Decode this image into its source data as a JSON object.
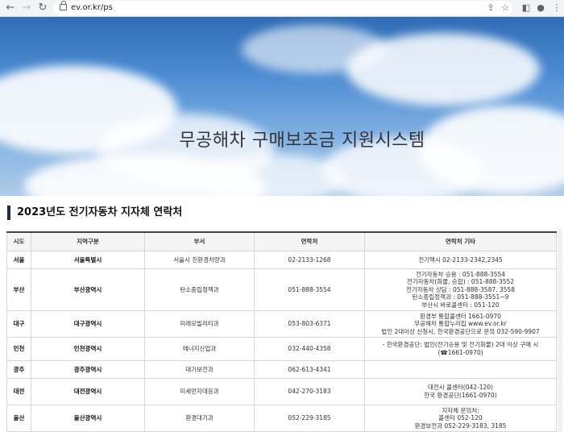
{
  "browser": {
    "url": "ev.or.kr/ps"
  },
  "hero": {
    "title": "무공해차 구매보조금 지원시스템"
  },
  "section": {
    "title": "2023년도 전기자동차 지자체 연락처"
  },
  "table": {
    "headers": [
      "시도",
      "지역구분",
      "부서",
      "연락처",
      "연락처 기타"
    ],
    "rows": [
      {
        "sido": "서울",
        "region": "서울특별시",
        "dept": "서울시 친환경차량과",
        "phone": "02-2133-1268",
        "etc": [
          "전기택시 02-2133-2342,2345"
        ]
      },
      {
        "sido": "부산",
        "region": "부산광역시",
        "dept": "탄소중립정책과",
        "phone": "051-888-3554",
        "etc": [
          "전기자동차 승용 : 051-888-3554",
          "전기자동차(화물, 승합) : 051-888-3552",
          "전기자동차 상담 : 051-888-3587, 3558",
          "탄소중립정책과 : 051-888-3551~9",
          "부산시 바로콜센터 : 051-120"
        ]
      },
      {
        "sido": "대구",
        "region": "대구광역시",
        "dept": "미래모빌리티과",
        "phone": "053-803-6371",
        "etc": [
          "환경부 통합콜센터 1661-0970",
          "무공해차 통합누리집 www.ev.or.kr",
          "법인 2대이상 신청시, 한국환경공단으로 문의 032-590-9907"
        ]
      },
      {
        "sido": "인천",
        "region": "인천광역시",
        "dept": "에너지산업과",
        "phone": "032-440-4358",
        "etc": [
          "- 한국환경공단: 법인(전기승용 및 전기화물) 2대 이상 구매 시",
          "(☎1661-0970)"
        ]
      },
      {
        "sido": "광주",
        "region": "광주광역시",
        "dept": "대기보전과",
        "phone": "062-613-4341",
        "etc": []
      },
      {
        "sido": "대전",
        "region": "대전광역시",
        "dept": "미세먼지대응과",
        "phone": "042-270-3183",
        "etc": [
          "대전시 콜센터(042-120)",
          "한국 환경공단(1661-0970)"
        ]
      },
      {
        "sido": "울산",
        "region": "울산광역시",
        "dept": "환경대기과",
        "phone": "052-229-3185",
        "etc": [
          "지자체 문의처:",
          "콜센터 052-120",
          "환경보전과 052-229-3183, 3185"
        ]
      }
    ]
  }
}
